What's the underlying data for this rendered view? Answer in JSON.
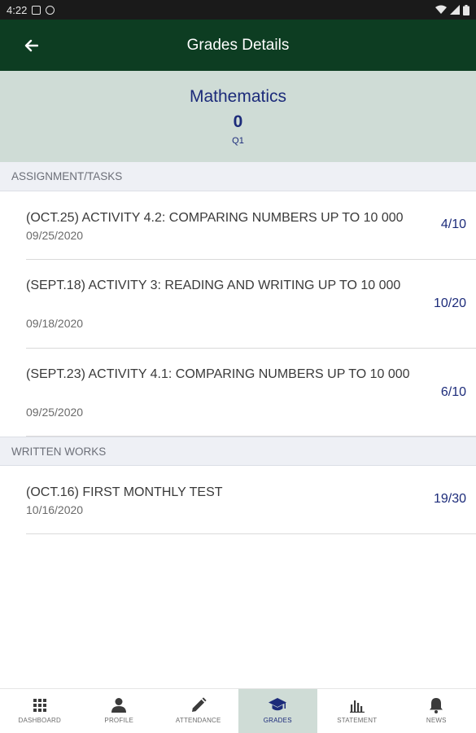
{
  "status_bar": {
    "time": "4:22"
  },
  "app_bar": {
    "title": "Grades Details"
  },
  "subject": {
    "name": "Mathematics",
    "score": "0",
    "quarter": "Q1"
  },
  "sections": [
    {
      "title": "ASSIGNMENT/TASKS",
      "items": [
        {
          "title": "(OCT.25) ACTIVITY 4.2: COMPARING NUMBERS UP TO 10 000",
          "date": "09/25/2020",
          "score": "4/10"
        },
        {
          "title": "(SEPT.18) ACTIVITY 3: READING AND WRITING UP TO 10 000",
          "date": "09/18/2020",
          "score": "10/20"
        },
        {
          "title": "(SEPT.23) ACTIVITY 4.1: COMPARING NUMBERS UP TO 10 000",
          "date": "09/25/2020",
          "score": "6/10"
        }
      ]
    },
    {
      "title": "WRITTEN WORKS",
      "items": [
        {
          "title": "(OCT.16) FIRST MONTHLY TEST",
          "date": "10/16/2020",
          "score": "19/30"
        }
      ]
    }
  ],
  "bottom_nav": [
    {
      "label": "DASHBOARD",
      "icon": "grid-icon",
      "active": false
    },
    {
      "label": "PROFILE",
      "icon": "person-icon",
      "active": false
    },
    {
      "label": "ATTENDANCE",
      "icon": "pencil-icon",
      "active": false
    },
    {
      "label": "GRADES",
      "icon": "graduation-cap-icon",
      "active": true
    },
    {
      "label": "STATEMENT",
      "icon": "bar-chart-icon",
      "active": false
    },
    {
      "label": "NEWS",
      "icon": "bell-icon",
      "active": false
    }
  ],
  "colors": {
    "appbar": "#0d3d22",
    "header_bg": "#cfdcd6",
    "accent": "#1c2b7a"
  }
}
